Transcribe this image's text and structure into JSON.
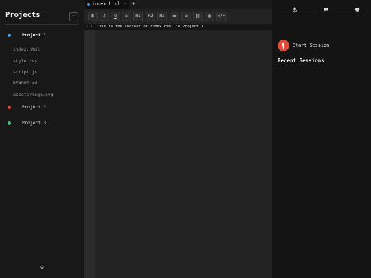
{
  "sidebar": {
    "title": "Projects",
    "add_label": "+",
    "projects": [
      {
        "name": "Project 1",
        "color": "#4b9be0",
        "active": true
      },
      {
        "name": "Project 2",
        "color": "#e0463a",
        "active": false
      },
      {
        "name": "Project 3",
        "color": "#3fc46a",
        "active": false
      }
    ],
    "files": [
      "index.html",
      "style.css",
      "script.js",
      "README.md",
      "assets/logo.svg"
    ],
    "settings_icon": "gear-icon"
  },
  "editor": {
    "tab": {
      "name": "index.html",
      "close": "×",
      "dot_color": "#4b9be0"
    },
    "new_tab": "+",
    "toolbar": {
      "bold": "B",
      "italic": "I",
      "underline": "U",
      "strike": "S",
      "h1": "H1",
      "h2": "H2",
      "h3": "H3",
      "bullet_list": "☰",
      "numbered_list": "≡",
      "link": "⛓",
      "image": "▣",
      "code": "</>"
    },
    "line_number": "1",
    "fold_marker": "‹",
    "content": "This is the content of index.html in Project 1"
  },
  "right_panel": {
    "tabs": [
      "mic-icon",
      "chat-icon",
      "brain-icon"
    ],
    "record_color": "#e04b3a",
    "start_session": "Start Session",
    "recent_title": "Recent Sessions"
  }
}
